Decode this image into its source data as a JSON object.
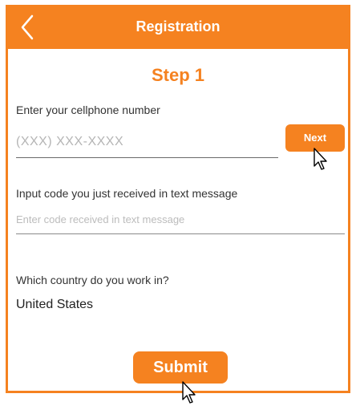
{
  "header": {
    "title": "Registration",
    "back_icon": "chevron-left-icon",
    "background_color": "#f58220"
  },
  "step": {
    "label": "Step 1"
  },
  "phone": {
    "label": "Enter your cellphone number",
    "placeholder": "(XXX) XXX-XXXX",
    "value": "",
    "next_label": "Next"
  },
  "code": {
    "label": "Input code you just received in text message",
    "placeholder": "Enter code received in text message",
    "value": ""
  },
  "country": {
    "label": "Which country do you work in?",
    "value": "United States"
  },
  "submit": {
    "label": "Submit"
  },
  "colors": {
    "accent": "#f58220"
  }
}
